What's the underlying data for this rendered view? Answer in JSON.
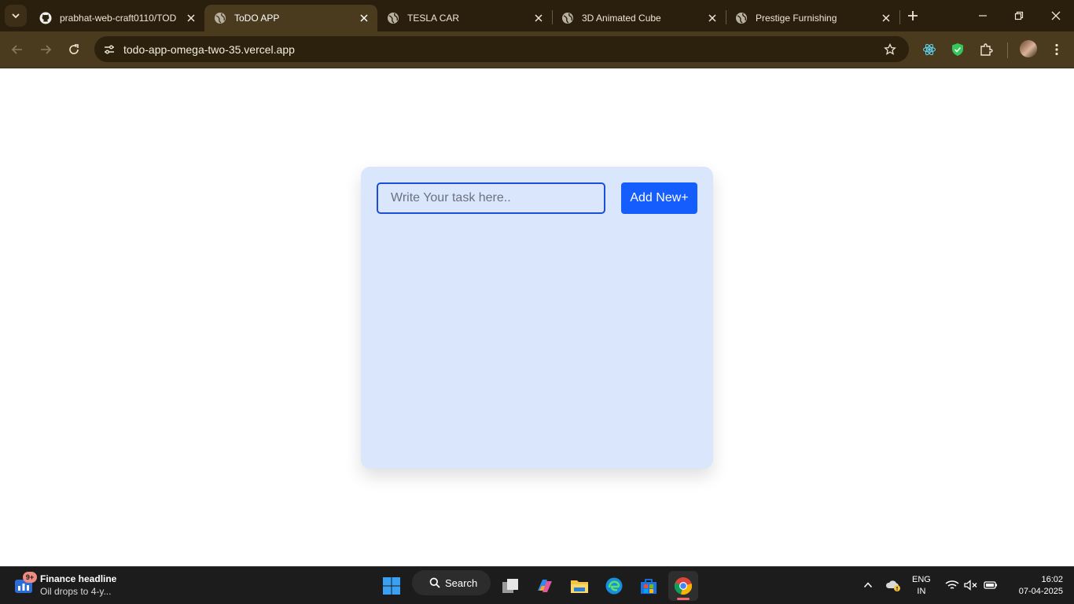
{
  "browser": {
    "tabs": [
      {
        "title": "prabhat-web-craft0110/TOD",
        "favicon": "github-icon",
        "active": false
      },
      {
        "title": "ToDO APP",
        "favicon": "globe-icon",
        "active": true
      },
      {
        "title": "TESLA CAR",
        "favicon": "globe-icon",
        "active": false
      },
      {
        "title": "3D Animated Cube",
        "favicon": "globe-icon",
        "active": false
      },
      {
        "title": "Prestige Furnishing",
        "favicon": "globe-icon",
        "active": false
      }
    ],
    "url": "todo-app-omega-two-35.vercel.app",
    "theme_color": "#4a3a1e"
  },
  "todo": {
    "input_placeholder": "Write Your task here..",
    "input_value": "",
    "add_button_label": "Add New+",
    "card_color": "#dae6fc",
    "accent_color": "#155dfc"
  },
  "taskbar": {
    "widget_badge": "9+",
    "news_headline": "Finance headline",
    "news_subtitle": "Oil drops to 4-y...",
    "search_label": "Search",
    "language_line1": "ENG",
    "language_line2": "IN",
    "time": "16:02",
    "date": "07-04-2025"
  }
}
